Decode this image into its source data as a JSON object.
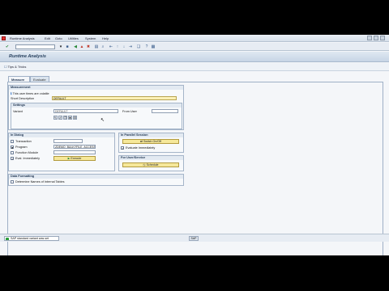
{
  "menu": [
    "Runtime Analysis",
    "Edit",
    "Goto",
    "Utilities",
    "System",
    "Help"
  ],
  "title": "Runtime Analysis",
  "app_toolbar": {
    "tips_tricks": "Tips & Tricks"
  },
  "tabs": [
    {
      "label": "Measure",
      "active": true
    },
    {
      "label": "Evaluate",
      "active": false
    }
  ],
  "measurement": {
    "group_title": "Measurement",
    "info_text": "This user times are volatile",
    "short_description_label": "Short Description",
    "short_description_value": "DEFAULT",
    "settings_title": "Settings",
    "variant_label": "Variant",
    "variant_value": "DEFAULT",
    "from_user_label": "From User",
    "from_user_value": ""
  },
  "in_dialog": {
    "title": "In Dialog",
    "transaction_label": "Transaction",
    "transaction_value": "",
    "program_label": "Program",
    "program_value": "ZDEMO_BULKYFILE_ACCESS",
    "function_module_label": "Function Module",
    "function_module_value": "",
    "eval_immediately_label": "Eval. Immediately",
    "execute_label": "Execute"
  },
  "in_parallel": {
    "title": "In Parallel Session",
    "switch_label": "Switch On/Off",
    "evaluate_immediately_label": "Evaluate Immediately"
  },
  "for_user_service": {
    "title": "For User/Service",
    "schedule_label": "Schedule"
  },
  "data_formatting": {
    "title": "Data Formatting",
    "determine_names_label": "Determine Names of Internal Tables"
  },
  "status": {
    "message": "SAP standard variant was set",
    "system": "SAP"
  },
  "colors": {
    "button": "#f6e89a",
    "required_field": "#fbf0b6",
    "title": "#27405e"
  }
}
